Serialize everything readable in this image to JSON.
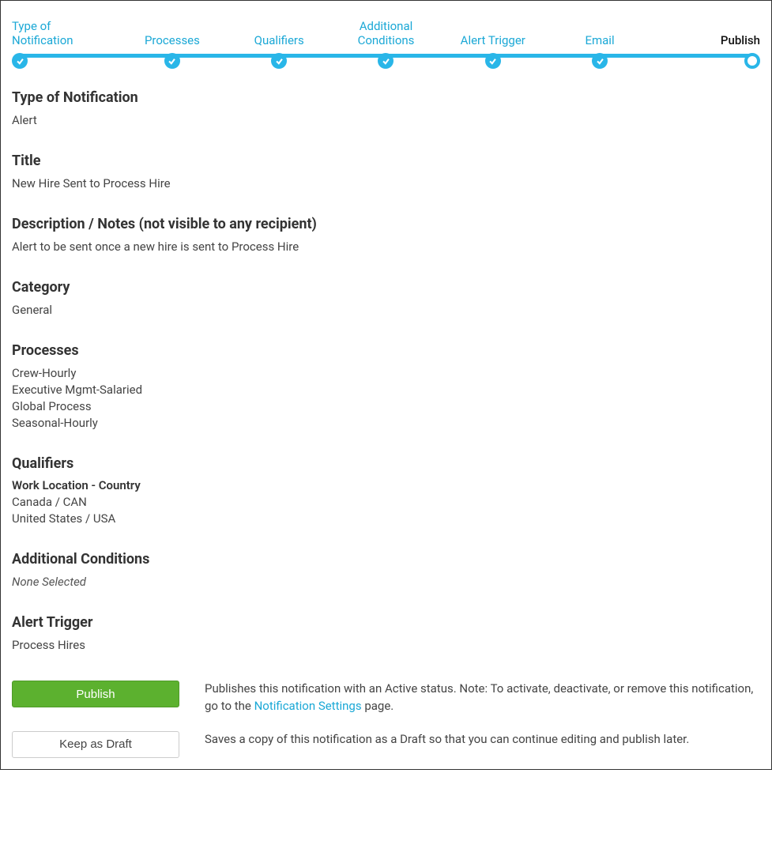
{
  "stepper": {
    "steps": [
      {
        "label": "Type of\nNotification",
        "done": true,
        "current": false
      },
      {
        "label": "Processes",
        "done": true,
        "current": false
      },
      {
        "label": "Qualifiers",
        "done": true,
        "current": false
      },
      {
        "label": "Additional\nConditions",
        "done": true,
        "current": false
      },
      {
        "label": "Alert Trigger",
        "done": true,
        "current": false
      },
      {
        "label": "Email",
        "done": true,
        "current": false
      },
      {
        "label": "Publish",
        "done": false,
        "current": true
      }
    ]
  },
  "sections": {
    "type_of_notification": {
      "heading": "Type of Notification",
      "value": "Alert"
    },
    "title": {
      "heading": "Title",
      "value": "New Hire Sent to Process Hire"
    },
    "description": {
      "heading": "Description / Notes (not visible to any recipient)",
      "value": "Alert to be sent once a new hire is sent to Process Hire"
    },
    "category": {
      "heading": "Category",
      "value": "General"
    },
    "processes": {
      "heading": "Processes",
      "items": [
        "Crew-Hourly",
        "Executive Mgmt-Salaried",
        "Global Process",
        "Seasonal-Hourly"
      ]
    },
    "qualifiers": {
      "heading": "Qualifiers",
      "sub_label": "Work Location - Country",
      "items": [
        "Canada / CAN",
        "United States / USA"
      ]
    },
    "additional_conditions": {
      "heading": "Additional Conditions",
      "value": "None Selected"
    },
    "alert_trigger": {
      "heading": "Alert Trigger",
      "value": "Process Hires"
    }
  },
  "actions": {
    "publish": {
      "button": "Publish",
      "desc_before": "Publishes this notification with an Active status. Note: To activate, deactivate, or remove this notification, go to the ",
      "link": "Notification Settings",
      "desc_after": " page."
    },
    "draft": {
      "button": "Keep as Draft",
      "desc": "Saves a copy of this notification as a Draft so that you can continue editing and publish later."
    }
  }
}
